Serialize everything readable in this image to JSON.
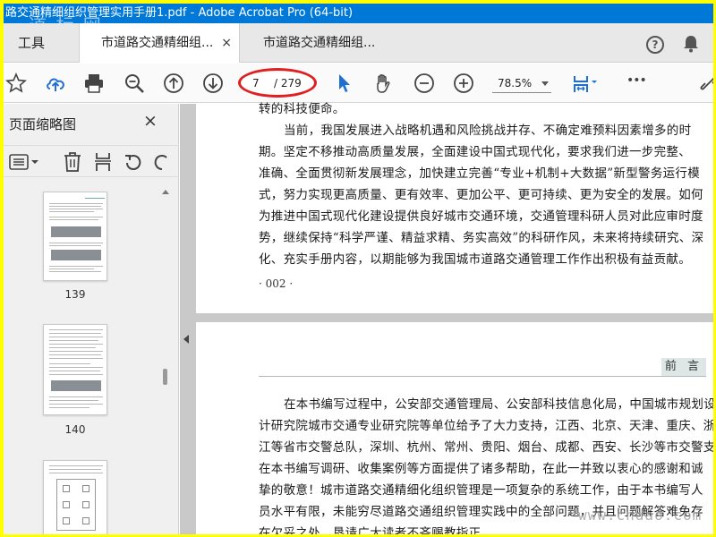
{
  "window": {
    "title": "路交通精细组织管理实用手册1.pdf - Adobe Acrobat Pro (64-bit)",
    "watermark": "道 标 网"
  },
  "tabs": {
    "tools_label": "工具",
    "items": [
      {
        "label": "市道路交通精细组...",
        "active": true
      },
      {
        "label": "市道路交通精细组...",
        "active": false
      }
    ],
    "close_glyph": "×",
    "help_glyph": "?"
  },
  "toolbar": {
    "icons": [
      "star-icon",
      "cloud-upload-icon",
      "print-icon",
      "zoom-search-icon",
      "page-up-icon",
      "page-down-icon",
      "select-cursor-icon",
      "hand-icon",
      "zoom-out-icon",
      "zoom-in-icon",
      "fit-page-icon",
      "more-icon",
      "link-icon"
    ],
    "current_page": "7",
    "total_pages": "/ 279",
    "zoom": "78.5%",
    "more_glyph": "•••",
    "accent_color": "#1f6fd1",
    "highlight_color": "#e02020"
  },
  "sidebar": {
    "title": "页面缩略图",
    "close_glyph": "×",
    "thumbnails": [
      {
        "label": "139"
      },
      {
        "label": "140"
      },
      {
        "label": ""
      }
    ]
  },
  "document": {
    "page_top_lines": [
      "转的科技便命。",
      "当前，我国发展进入战略机遇和风险挑战并存、不确定难预料因素增多的时",
      "期。坚定不移推动高质量发展，全面建设中国式现代化，要求我们进一步完整、",
      "准确、全面贯彻新发展理念，加快建立完善“专业+机制+大数据”新型警务运行模",
      "式，努力实现更高质量、更有效率、更加公平、更可持续、更为安全的发展。如何",
      "为推进中国式现代化建设提供良好城市交通环境，交通管理科研人员对此应审时度",
      "势，继续保持“科学严谨、精益求精、务实高效”的科研作风，未来将持续研究、深",
      "化、充实手册内容，以期能够为我国城市道路交通管理工作作出积极有益贡献。"
    ],
    "page_number": "· 002 ·",
    "section_tag": "前 言",
    "page_bottom_lines": [
      "在本书编写过程中，公安部交通管理局、公安部科技信息化局，中国城市规划设",
      "计研究院城市交通专业研究院等单位给予了大力支持，江西、北京、天津、重庆、浙",
      "江等省市交警总队，深圳、杭州、常州、贵阳、烟台、成都、西安、长沙等市交警支队",
      "在本书编写调研、收集案例等方面提供了诸多帮助，在此一并致以衷心的感谢和诚",
      "挚的敬意！城市道路交通精细化组织管理是一项复杂的系统工作，由于本书编写人",
      "员水平有限，未能穷尽道路交通组织管理实践中的全部问题，并且问题解答难免存",
      "在欠妥之处，恳请广大读者不吝赐教指正。"
    ],
    "watermark": "www.cndao.com"
  }
}
